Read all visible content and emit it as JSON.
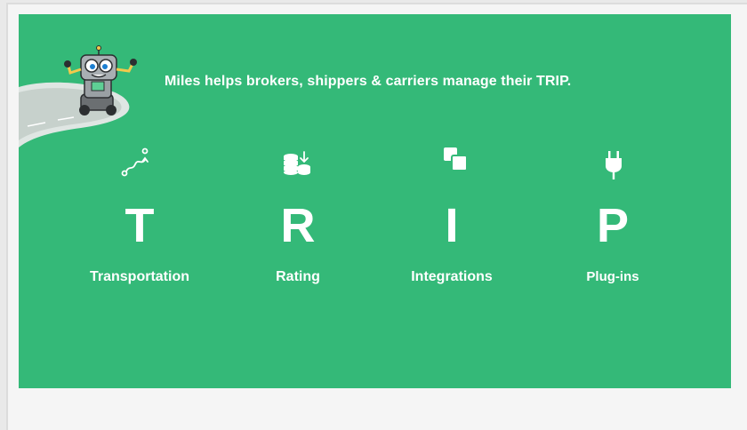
{
  "header": {
    "tagline": "Miles helps brokers, shippers & carriers manage their TRIP.",
    "mascot_icon": "robot-mascot-on-road-icon"
  },
  "pillars": [
    {
      "letter": "T",
      "label": "Transportation",
      "icon": "route-icon"
    },
    {
      "letter": "R",
      "label": "Rating",
      "icon": "coin-stack-icon"
    },
    {
      "letter": "I",
      "label": "Integrations",
      "icon": "overlapping-squares-icon"
    },
    {
      "letter": "P",
      "label": "Plug-ins",
      "icon": "plug-icon"
    }
  ],
  "colors": {
    "panel": "#34b978",
    "text": "#ffffff",
    "page_background": "#f5f5f5"
  }
}
